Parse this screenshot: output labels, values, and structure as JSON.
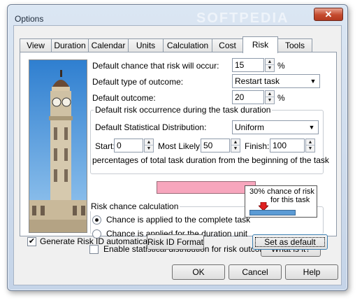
{
  "window": {
    "title": "Options",
    "close_glyph": "✕",
    "watermark": "SOFTPEDIA"
  },
  "tabs": [
    {
      "label": "View"
    },
    {
      "label": "Duration"
    },
    {
      "label": "Calendar"
    },
    {
      "label": "Units"
    },
    {
      "label": "Calculation"
    },
    {
      "label": "Cost"
    },
    {
      "label": "Risk",
      "active": true
    },
    {
      "label": "Tools"
    }
  ],
  "risk": {
    "chance_label": "Default chance that risk will occur:",
    "chance_value": "15",
    "chance_unit": "%",
    "outcome_type_label": "Default type of outcome:",
    "outcome_type_value": "Restart task",
    "outcome_label": "Default outcome:",
    "outcome_value": "20",
    "outcome_unit": "%"
  },
  "occurrence": {
    "group_label": "Default risk occurrence during the task duration",
    "distribution_label": "Default Statistical Distribution:",
    "distribution_value": "Uniform",
    "start_label": "Start:",
    "start_value": "0",
    "most_likely_label": "Most Likely:",
    "most_likely_value": "50",
    "finish_label": "Finish:",
    "finish_value": "100",
    "note": "percentages of total task duration from the beginning of the task"
  },
  "chance_calc": {
    "group_label": "Risk chance calculation",
    "option_complete": "Chance is applied to the complete task",
    "option_unit": "Chance is applied for the duration unit",
    "selected": "complete",
    "indicator_line1": "30% chance of risk",
    "indicator_line2": "for this task"
  },
  "stat_dist": {
    "label": "Enable statistical distribution for risk outcome",
    "checked": false,
    "whatis_label": "What is it?"
  },
  "bottom": {
    "generate_id_label": "Generate Risk ID automatically",
    "generate_id_checked": true,
    "id_format_label": "Risk ID Format",
    "set_default_label": "Set as default",
    "ok_label": "OK",
    "cancel_label": "Cancel",
    "help_label": "Help"
  },
  "colors": {
    "pink_bar": "#f7a6bd",
    "indicator_bar": "#5b9bd5",
    "indicator_arrow": "#e02020"
  },
  "icons": {
    "spin_up": "▲",
    "spin_down": "▼",
    "dropdown": "▼",
    "check": "✔"
  }
}
